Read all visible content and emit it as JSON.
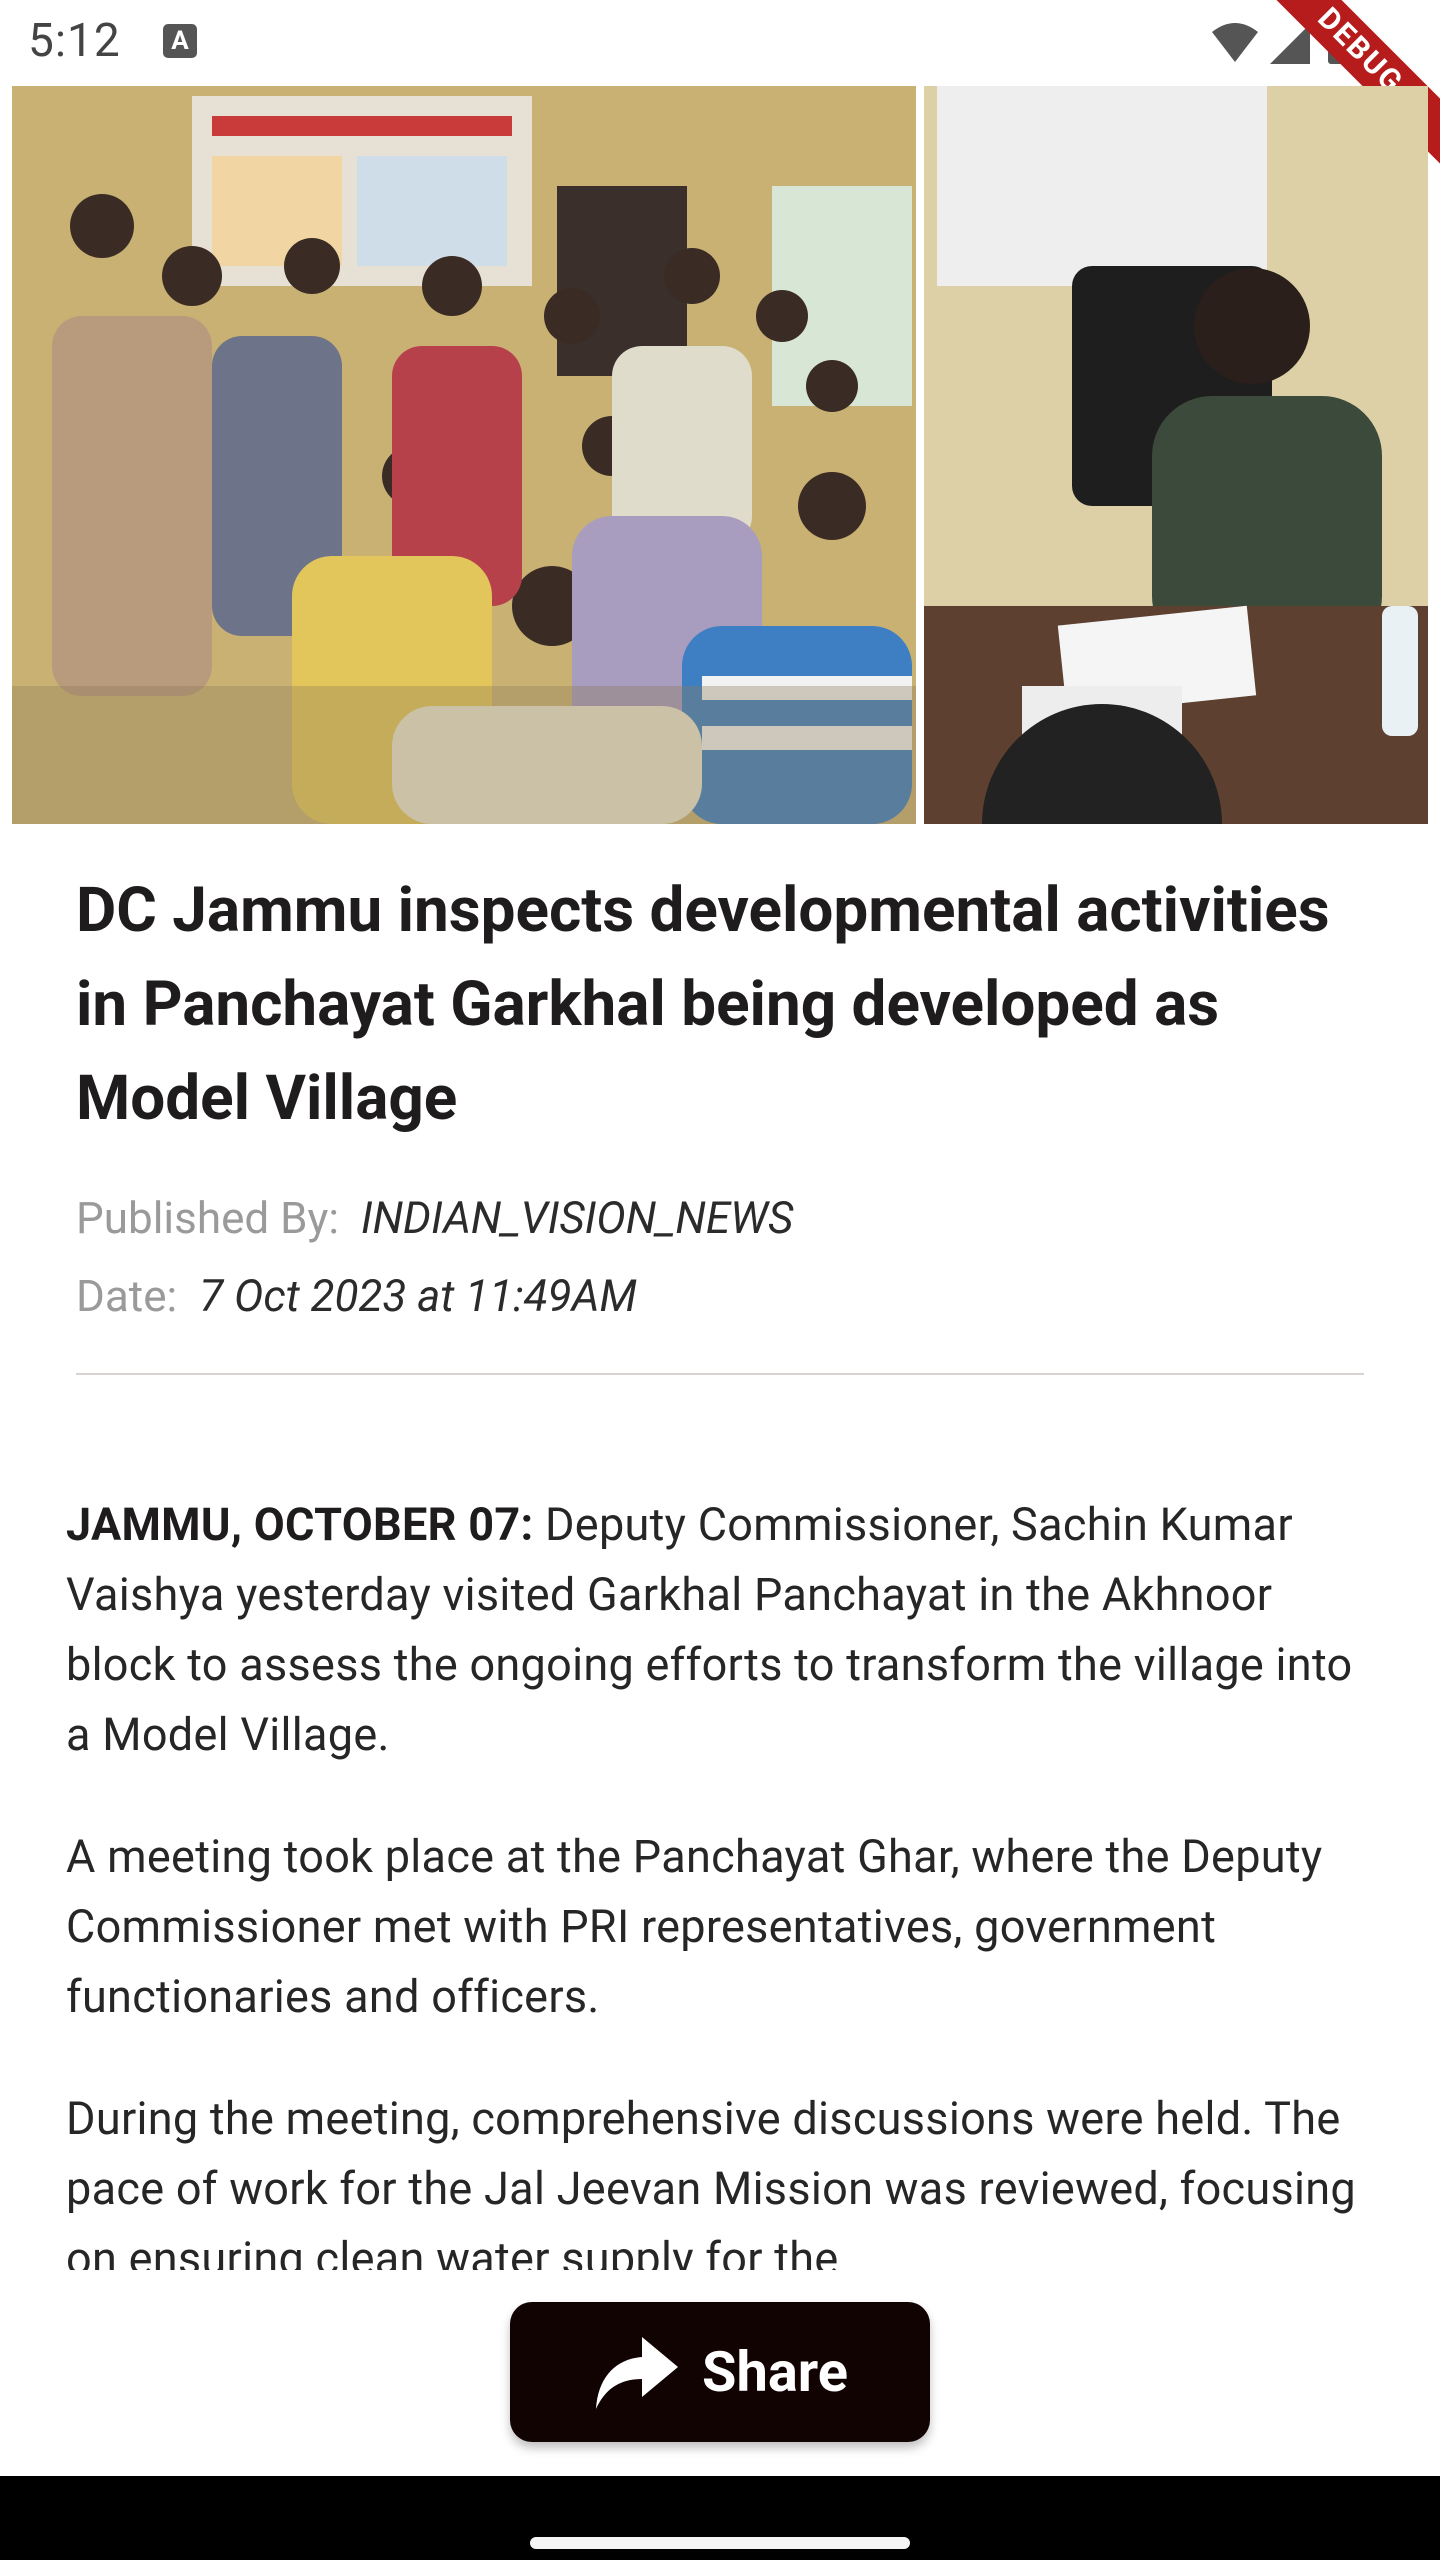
{
  "status_bar": {
    "time": "5:12",
    "notification_icon": "A",
    "icons": [
      "wifi-icon",
      "signal-icon",
      "battery-icon"
    ],
    "debug_banner": "DEBUG"
  },
  "article": {
    "title": "DC Jammu inspects developmental activities in Panchayat Garkhal being developed as Model Village",
    "published_by_label": "Published By:",
    "publisher": "INDIAN_VISION_NEWS",
    "date_label": "Date:",
    "date": "7 Oct 2023 at 11:49AM",
    "paragraphs": [
      {
        "lead": "JAMMU, OCTOBER 07:",
        "text": " Deputy Commissioner, Sachin Kumar Vaishya yesterday visited Garkhal Panchayat in the Akhnoor block to assess the ongoing efforts to transform the village into a Model Village."
      },
      {
        "text": "A meeting took place at the Panchayat Ghar, where the Deputy Commissioner met with PRI representatives, government functionaries and officers."
      },
      {
        "text": "During the meeting, comprehensive discussions were held. The pace of work for the Jal Jeevan Mission was reviewed, focusing on ensuring clean water supply for the"
      }
    ]
  },
  "share_button": {
    "label": "Share",
    "icon": "share-arrow-icon"
  },
  "colors": {
    "button_bg": "#120303",
    "meta_label": "#9a9a9a",
    "debug_ribbon": "#b71c1c"
  }
}
